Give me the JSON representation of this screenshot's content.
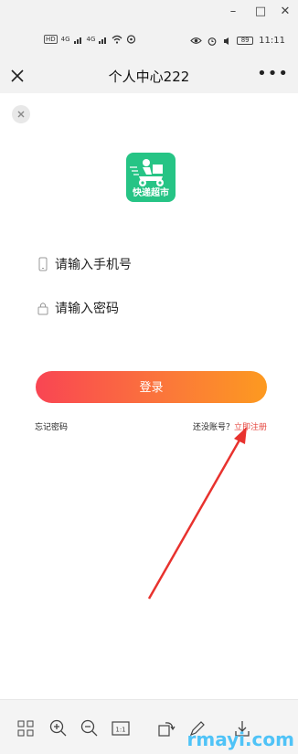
{
  "window": {
    "minimize": "–",
    "maximize": "□",
    "close": "✕"
  },
  "status_bar": {
    "sim1": "HD",
    "sim2": "HD",
    "net1": "4G",
    "net2": "4G",
    "battery": "89",
    "time": "11:11"
  },
  "nav": {
    "title": "个人中心222",
    "more": "•••"
  },
  "logo": {
    "text": "快递超市",
    "color": "#26c485"
  },
  "form": {
    "phone_placeholder": "请输入手机号",
    "password_placeholder": "请输入密码",
    "login_label": "登录"
  },
  "links": {
    "forgot": "忘记密码",
    "no_account": "还没账号？",
    "register": "立即注册"
  },
  "watermark": "rmayi.com",
  "colors": {
    "accent_start": "#f94553",
    "accent_end": "#fd9a20",
    "link": "#e54840",
    "arrow": "#e8322e"
  }
}
